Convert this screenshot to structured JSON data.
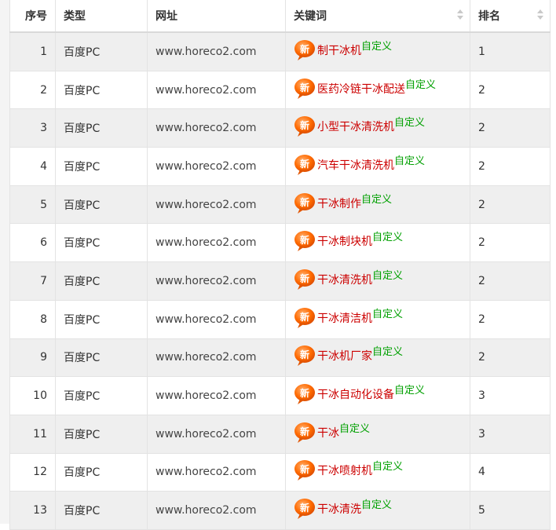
{
  "header": {
    "seq": "序号",
    "type": "类型",
    "url": "网址",
    "keyword": "关键词",
    "rank": "排名"
  },
  "badge_label": "新",
  "custom_label": "自定义",
  "colors": {
    "keyword": "#cc0000",
    "custom": "#00a000",
    "badge": "#ff6a00"
  },
  "rows": [
    {
      "seq": "1",
      "type": "百度PC",
      "url": "www.horeco2.com",
      "keyword": "制干冰机",
      "rank": "1"
    },
    {
      "seq": "2",
      "type": "百度PC",
      "url": "www.horeco2.com",
      "keyword": "医药冷链干冰配送",
      "rank": "2"
    },
    {
      "seq": "3",
      "type": "百度PC",
      "url": "www.horeco2.com",
      "keyword": "小型干冰清洗机",
      "rank": "2"
    },
    {
      "seq": "4",
      "type": "百度PC",
      "url": "www.horeco2.com",
      "keyword": "汽车干冰清洗机",
      "rank": "2"
    },
    {
      "seq": "5",
      "type": "百度PC",
      "url": "www.horeco2.com",
      "keyword": "干冰制作",
      "rank": "2"
    },
    {
      "seq": "6",
      "type": "百度PC",
      "url": "www.horeco2.com",
      "keyword": "干冰制块机",
      "rank": "2"
    },
    {
      "seq": "7",
      "type": "百度PC",
      "url": "www.horeco2.com",
      "keyword": "干冰清洗机",
      "rank": "2"
    },
    {
      "seq": "8",
      "type": "百度PC",
      "url": "www.horeco2.com",
      "keyword": "干冰清洁机",
      "rank": "2"
    },
    {
      "seq": "9",
      "type": "百度PC",
      "url": "www.horeco2.com",
      "keyword": "干冰机厂家",
      "rank": "2"
    },
    {
      "seq": "10",
      "type": "百度PC",
      "url": "www.horeco2.com",
      "keyword": "干冰自动化设备",
      "rank": "3"
    },
    {
      "seq": "11",
      "type": "百度PC",
      "url": "www.horeco2.com",
      "keyword": "干冰",
      "rank": "3"
    },
    {
      "seq": "12",
      "type": "百度PC",
      "url": "www.horeco2.com",
      "keyword": "干冰喷射机",
      "rank": "4"
    },
    {
      "seq": "13",
      "type": "百度PC",
      "url": "www.horeco2.com",
      "keyword": "干冰清洗",
      "rank": "5"
    }
  ]
}
